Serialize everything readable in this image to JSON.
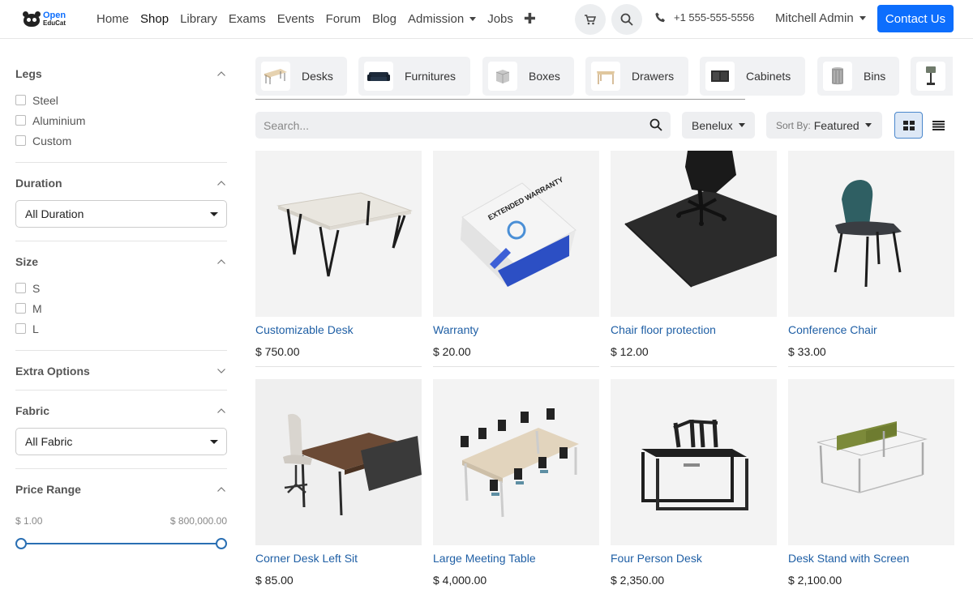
{
  "brand": {
    "line1": "Open",
    "line2": "EduCat"
  },
  "nav": {
    "items": [
      "Home",
      "Shop",
      "Library",
      "Exams",
      "Events",
      "Forum",
      "Blog",
      "Admission",
      "Jobs"
    ],
    "active": "Shop",
    "phone": "+1 555-555-5556",
    "user": "Mitchell Admin",
    "contact": "Contact Us"
  },
  "filters": {
    "legs": {
      "title": "Legs",
      "options": [
        "Steel",
        "Aluminium",
        "Custom"
      ]
    },
    "duration": {
      "title": "Duration",
      "selected": "All Duration"
    },
    "size": {
      "title": "Size",
      "options": [
        "S",
        "M",
        "L"
      ]
    },
    "extra": {
      "title": "Extra Options"
    },
    "fabric": {
      "title": "Fabric",
      "selected": "All Fabric"
    },
    "price": {
      "title": "Price Range",
      "min": "$ 1.00",
      "max": "$ 800,000.00",
      "low_fraction": 0,
      "high_fraction": 1
    }
  },
  "categories": [
    "Desks",
    "Furnitures",
    "Boxes",
    "Drawers",
    "Cabinets",
    "Bins"
  ],
  "toolbar": {
    "search_placeholder": "Search...",
    "pricelist": "Benelux",
    "sort_prefix": "Sort By:",
    "sort_value": "Featured"
  },
  "products": [
    {
      "name": "Customizable Desk",
      "price": "$ 750.00"
    },
    {
      "name": "Warranty",
      "price": "$ 20.00"
    },
    {
      "name": "Chair floor protection",
      "price": "$ 12.00"
    },
    {
      "name": "Conference Chair",
      "price": "$ 33.00"
    },
    {
      "name": "Corner Desk Left Sit",
      "price": "$ 85.00"
    },
    {
      "name": "Large Meeting Table",
      "price": "$ 4,000.00"
    },
    {
      "name": "Four Person Desk",
      "price": "$ 2,350.00"
    },
    {
      "name": "Desk Stand with Screen",
      "price": "$ 2,100.00"
    }
  ],
  "warranty_label": "EXTENDED WARRANTY",
  "colors": {
    "primary": "#0d6efd",
    "link": "#1f5fa5",
    "slider": "#2a6fb3"
  }
}
